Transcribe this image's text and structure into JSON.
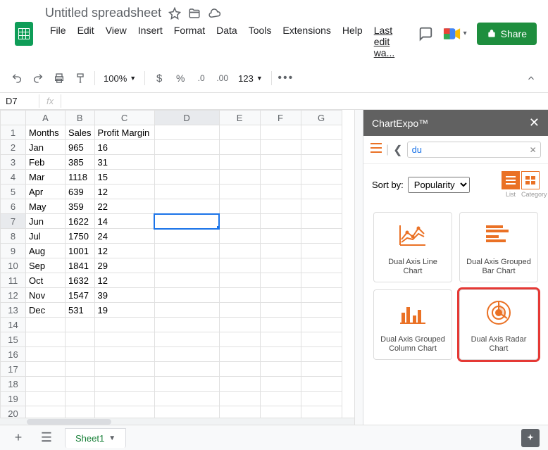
{
  "doc": {
    "title": "Untitled spreadsheet"
  },
  "menus": [
    "File",
    "Edit",
    "View",
    "Insert",
    "Format",
    "Data",
    "Tools",
    "Extensions",
    "Help"
  ],
  "last_edit": "Last edit wa...",
  "share_label": "Share",
  "toolbar": {
    "zoom": "100%",
    "fmt": "123"
  },
  "cell_ref": "D7",
  "columns": [
    "A",
    "B",
    "C",
    "D",
    "E",
    "F",
    "G"
  ],
  "rows": 21,
  "selected": {
    "row": 7,
    "col": "D"
  },
  "data": {
    "headers": [
      "Months",
      "Sales",
      "Profit Margin"
    ],
    "rows": [
      [
        "Jan",
        "965",
        "16"
      ],
      [
        "Feb",
        "385",
        "31"
      ],
      [
        "Mar",
        "1118",
        "15"
      ],
      [
        "Apr",
        "639",
        "12"
      ],
      [
        "May",
        "359",
        "22"
      ],
      [
        "Jun",
        "1622",
        "14"
      ],
      [
        "Jul",
        "1750",
        "24"
      ],
      [
        "Aug",
        "1001",
        "12"
      ],
      [
        "Sep",
        "1841",
        "29"
      ],
      [
        "Oct",
        "1632",
        "12"
      ],
      [
        "Nov",
        "1547",
        "39"
      ],
      [
        "Dec",
        "531",
        "19"
      ]
    ]
  },
  "sidepanel": {
    "title": "ChartExpo™",
    "search_value": "du",
    "sort_label": "Sort by:",
    "sort_value": "Popularity",
    "view_list": "List",
    "view_cat": "Category",
    "charts": [
      "Dual Axis Line Chart",
      "Dual Axis Grouped Bar Chart",
      "Dual Axis Grouped Column Chart",
      "Dual Axis Radar Chart"
    ],
    "highlighted_index": 3
  },
  "sheet_tab": "Sheet1"
}
